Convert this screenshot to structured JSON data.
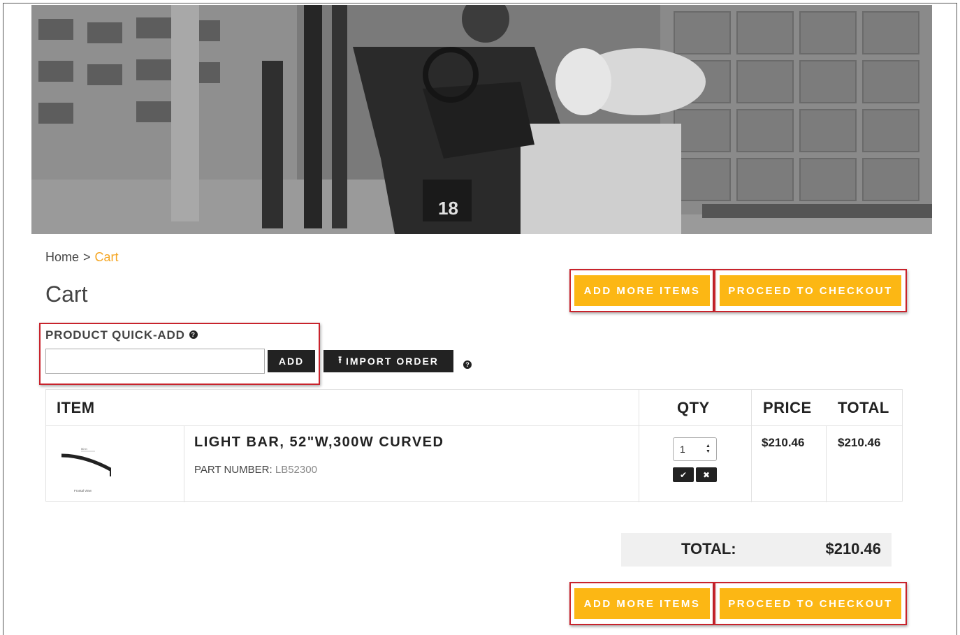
{
  "breadcrumb": {
    "home": "Home",
    "separator": ">",
    "current": "Cart"
  },
  "page": {
    "title": "Cart"
  },
  "actions": {
    "add_more_items": "ADD MORE ITEMS",
    "proceed_to_checkout": "PROCEED TO CHECKOUT"
  },
  "quick_add": {
    "label": "PRODUCT QUICK-ADD",
    "help_glyph": "?",
    "input_value": "",
    "add_label": "ADD",
    "import_label": "IMPORT ORDER",
    "import_icon": "upload-icon"
  },
  "table": {
    "headers": {
      "item": "ITEM",
      "qty": "QTY",
      "price": "PRICE",
      "total": "TOTAL"
    },
    "rows": [
      {
        "title": "LIGHT BAR, 52\"W,300W CURVED",
        "part_label": "PART NUMBER:",
        "part_number": "LB52300",
        "qty": "1",
        "price": "$210.46",
        "total": "$210.46",
        "thumb_dimension": "50 in",
        "thumb_caption": "Frontal View"
      }
    ]
  },
  "summary": {
    "label": "TOTAL:",
    "value": "$210.46"
  },
  "colors": {
    "accent": "#fcb714",
    "breadcrumb_current": "#f5a623",
    "highlight": "#c8232c",
    "dark_button": "#222222"
  },
  "icons": {
    "confirm": "check-icon",
    "remove": "close-icon",
    "help": "help-circle-icon",
    "spinner": "stepper-arrows-icon"
  }
}
